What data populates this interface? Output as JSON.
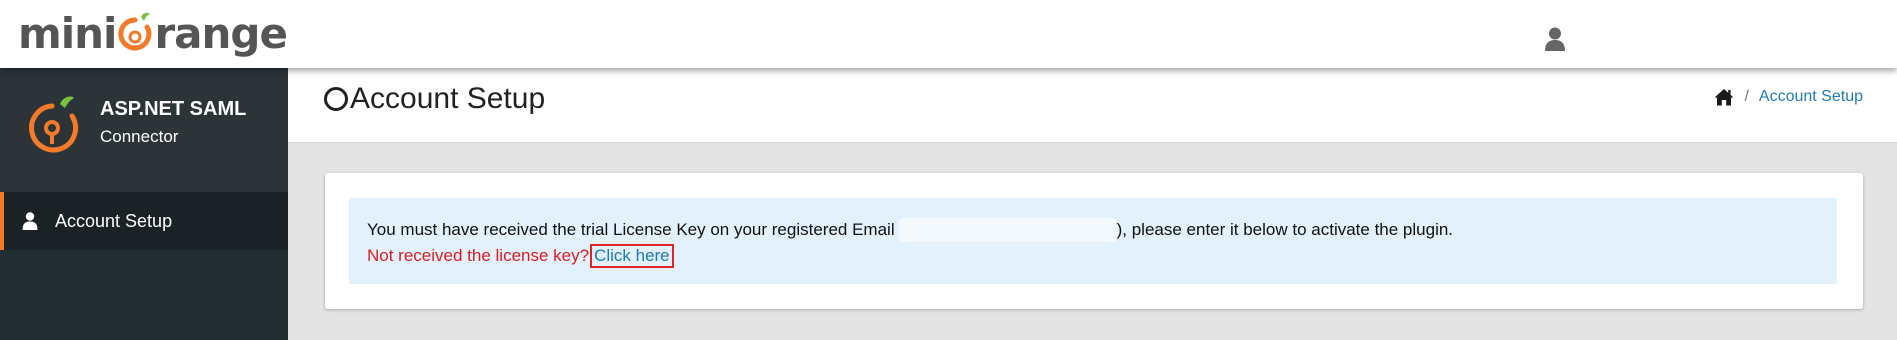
{
  "header": {
    "logo_text_left": "mini",
    "logo_text_right": "range",
    "user_icon": "user-icon"
  },
  "sidebar": {
    "brand_title": "ASP.NET SAML",
    "brand_subtitle": "Connector",
    "items": [
      {
        "label": "Account Setup",
        "icon": "user-icon",
        "active": true
      }
    ]
  },
  "content": {
    "page_title": "Account Setup",
    "title_icon": "circle-icon",
    "breadcrumb": {
      "home_icon": "home-icon",
      "separator": "/",
      "current": "Account Setup"
    }
  },
  "alert": {
    "line1_before": "You must have received the trial License Key on your registered Email",
    "line1_after": "), please enter it below to activate the plugin.",
    "line2_text": "Not received the license key?",
    "line2_link": "Click here"
  },
  "colors": {
    "accent": "#f47a2a",
    "sidebar_bg": "#222d32",
    "link": "#1e7bb5",
    "warning": "#dd1c1c",
    "alert_bg": "#e2f1fb"
  }
}
